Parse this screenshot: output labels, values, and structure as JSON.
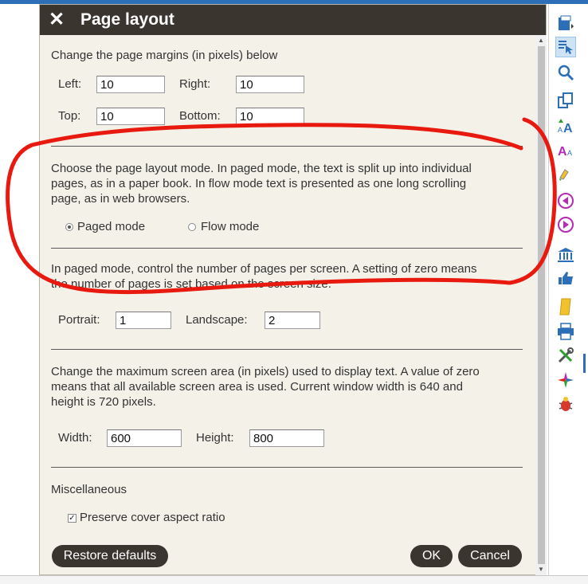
{
  "dialog": {
    "title": "Page layout",
    "margins": {
      "intro": "Change the page margins (in pixels) below",
      "left_label": "Left:",
      "left_value": "10",
      "right_label": "Right:",
      "right_value": "10",
      "top_label": "Top:",
      "top_value": "10",
      "bottom_label": "Bottom:",
      "bottom_value": "10"
    },
    "layout_mode": {
      "line1": "Choose the page layout mode. In paged mode, the text is split up into individual",
      "line2": "pages, as in a paper book. In flow mode text is presented as one long scrolling",
      "line3": "page, as in web browsers.",
      "paged_label": "Paged mode",
      "flow_label": "Flow mode",
      "selected": "Paged mode"
    },
    "pages_per_screen": {
      "line1": "In paged mode, control the number of pages per screen. A setting of zero means",
      "line2": "the number of pages is set based on the screen size.",
      "portrait_label": "Portrait:",
      "portrait_value": "1",
      "landscape_label": "Landscape:",
      "landscape_value": "2"
    },
    "screen_area": {
      "line1": "Change the maximum screen area (in pixels) used to display text. A value of zero",
      "line2": "means that all available screen area is used. Current window width is 640 and",
      "line3": "height is 720 pixels.",
      "width_label": "Width:",
      "width_value": "600",
      "height_label": "Height:",
      "height_value": "800"
    },
    "misc": {
      "heading": "Miscellaneous",
      "preserve_label": "Preserve cover aspect ratio",
      "preserve_checked": true
    },
    "buttons": {
      "restore": "Restore defaults",
      "ok": "OK",
      "cancel": "Cancel"
    }
  },
  "toolbar": {
    "icons": [
      "open-book-icon",
      "select-pointer-icon",
      "search-icon",
      "copy-icon",
      "font-larger-icon",
      "font-smaller-icon",
      "color-picker-icon",
      "previous-icon",
      "next-icon",
      "library-icon",
      "thumbs-up-icon",
      "bookmark-icon",
      "print-icon",
      "settings-tools-icon",
      "plugins-icon",
      "bug-icon"
    ]
  },
  "colors": {
    "titlebar": "#3b3530",
    "dialog_bg": "#f3f1e8",
    "annotation": "#e8190f",
    "accent": "#2d6fb7"
  }
}
